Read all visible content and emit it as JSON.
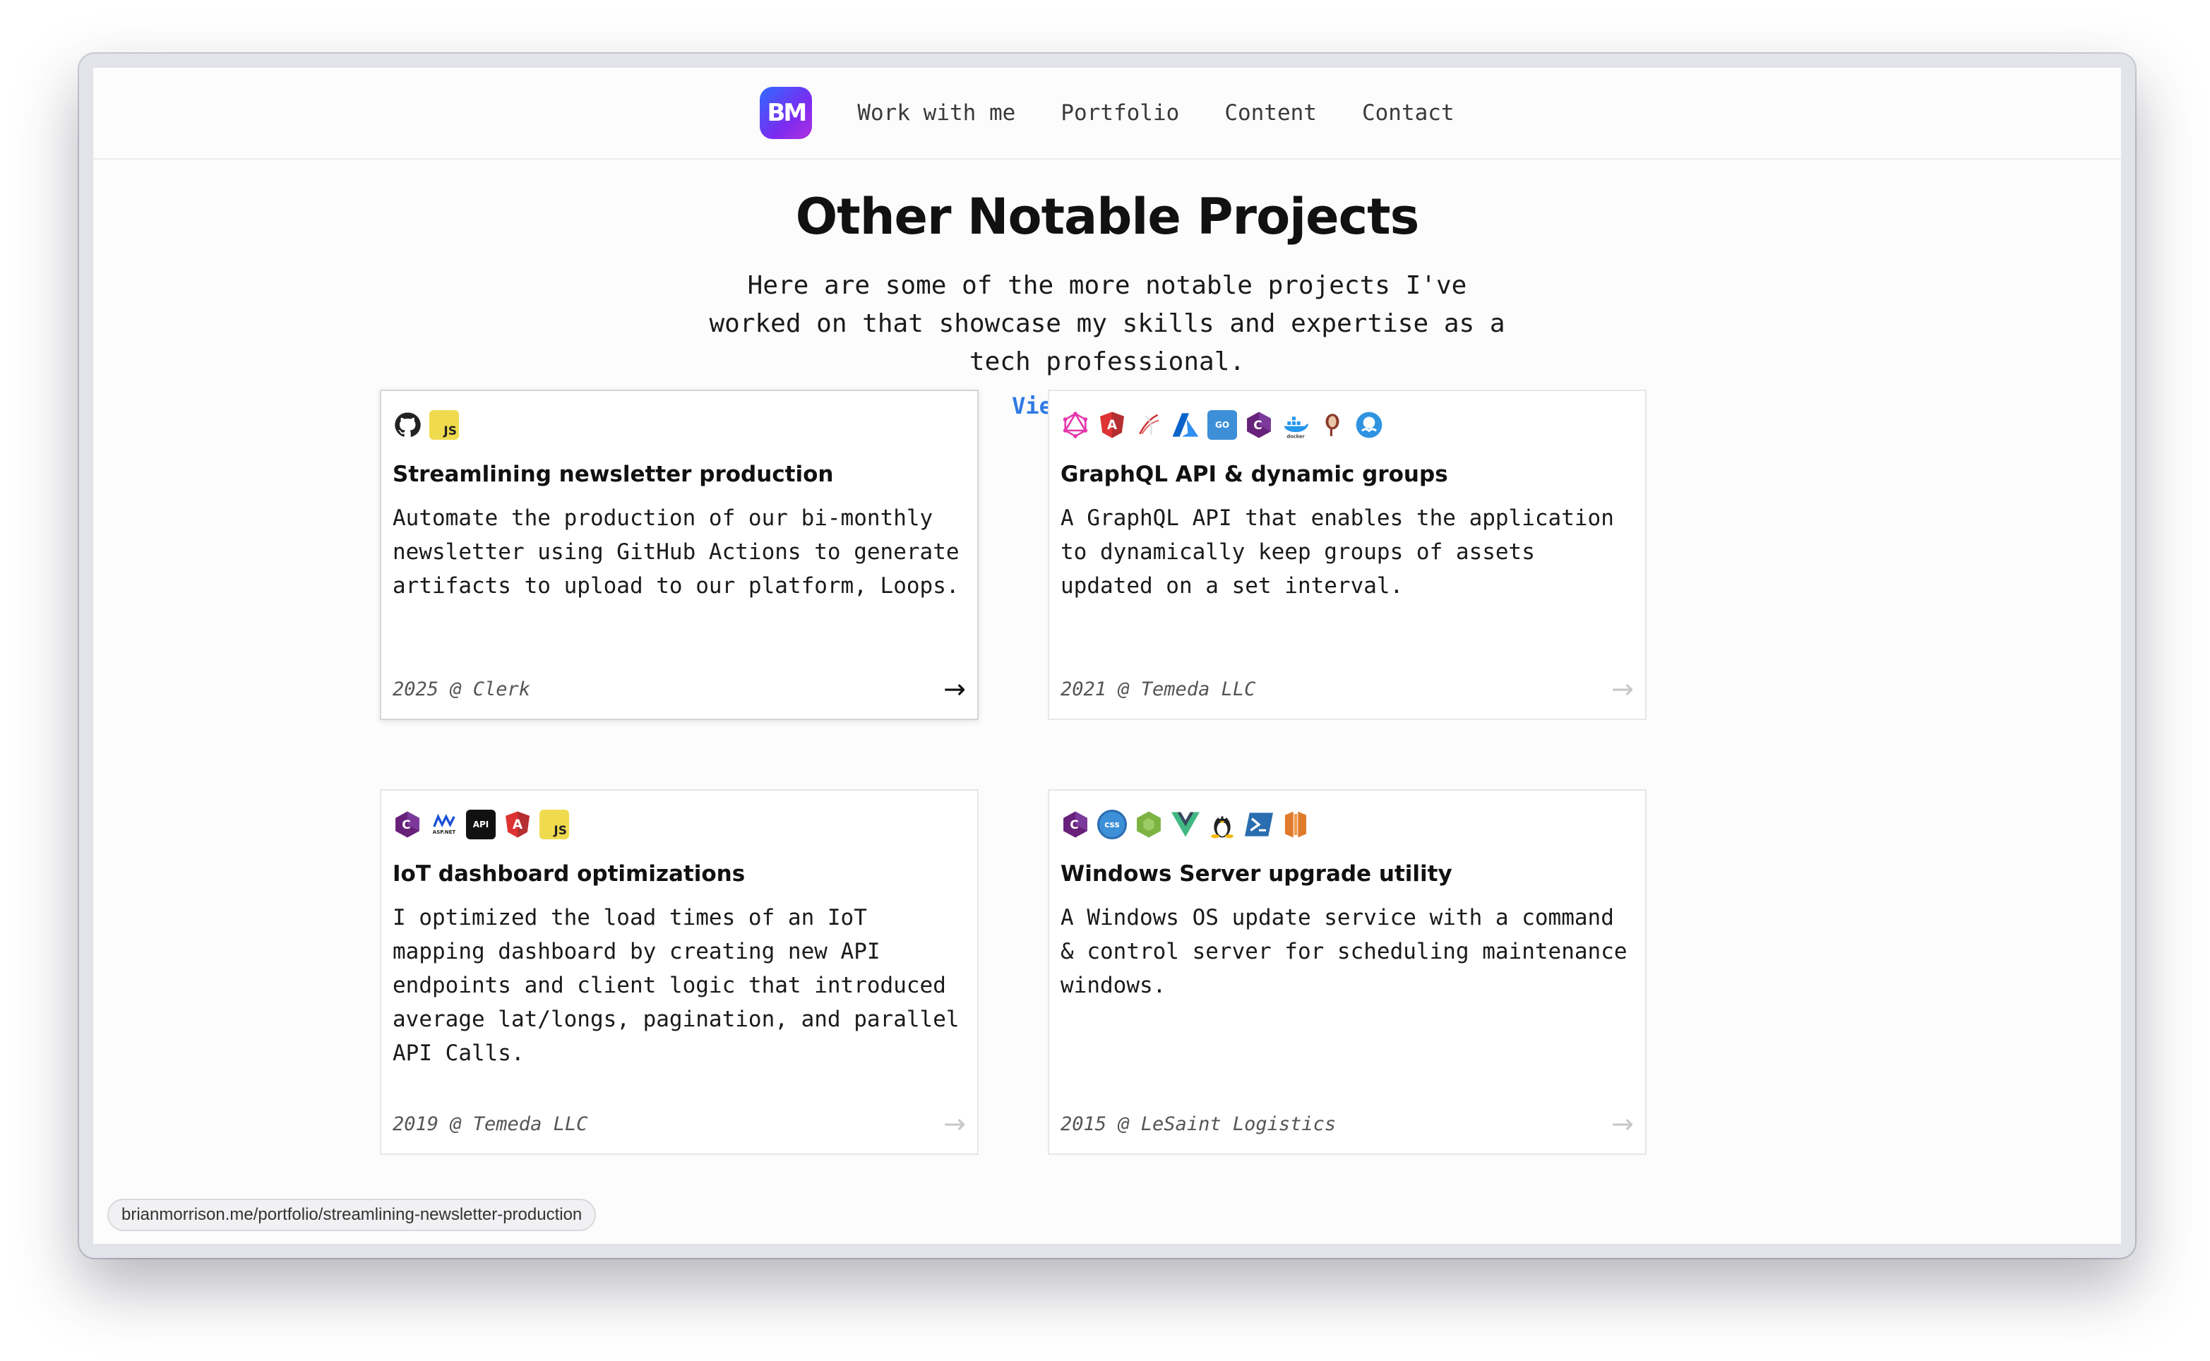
{
  "nav": {
    "logo_text": "BM",
    "links": [
      "Work with me",
      "Portfolio",
      "Content",
      "Contact"
    ]
  },
  "hero": {
    "title": "Other Notable Projects",
    "description": "Here are some of the more notable projects I've worked on that showcase my skills and expertise as a tech professional.",
    "cta": "View Portfolio"
  },
  "projects": [
    {
      "title": "Streamlining newsletter production",
      "description": "Automate the production of our bi-monthly newsletter using GitHub Actions to generate artifacts to upload to our platform, Loops.",
      "meta": "2025 @ Clerk",
      "icons": [
        "github-icon",
        "javascript-icon"
      ]
    },
    {
      "title": "GraphQL API & dynamic groups",
      "description": "A GraphQL API that enables the application to dynamically keep groups of assets updated on a set interval.",
      "meta": "2021 @ Temeda LLC",
      "icons": [
        "graphql-icon",
        "angular-icon",
        "sql-server-icon",
        "azure-icon",
        "go-icon",
        "csharp-icon",
        "docker-icon",
        "postgres-icon",
        "octopus-icon"
      ]
    },
    {
      "title": "IoT dashboard optimizations",
      "description": "I optimized the load times of an IoT mapping dashboard by creating new API endpoints and client logic that introduced average lat/longs, pagination, and parallel API Calls.",
      "meta": "2019 @ Temeda LLC",
      "icons": [
        "csharp-icon",
        "aspnet-icon",
        "api-icon",
        "angular-icon",
        "javascript-icon"
      ]
    },
    {
      "title": "Windows Server upgrade utility",
      "description": "A Windows OS update service with a command & control server for scheduling maintenance windows.",
      "meta": "2015 @ LeSaint Logistics",
      "icons": [
        "csharp-icon",
        "css-icon",
        "nodejs-icon",
        "vue-icon",
        "linux-icon",
        "powershell-icon",
        "aws-icon"
      ]
    }
  ],
  "icon_labels": {
    "javascript": "JS",
    "go": "GO",
    "api": "API",
    "css": "css",
    "aspnet": "ASP.NET"
  },
  "status_url": "brianmorrison.me/portfolio/streamlining-newsletter-production",
  "colors": {
    "link": "#2f7ae5",
    "logo_gradient_start": "#2f6bff",
    "logo_gradient_end": "#b12fe0"
  }
}
